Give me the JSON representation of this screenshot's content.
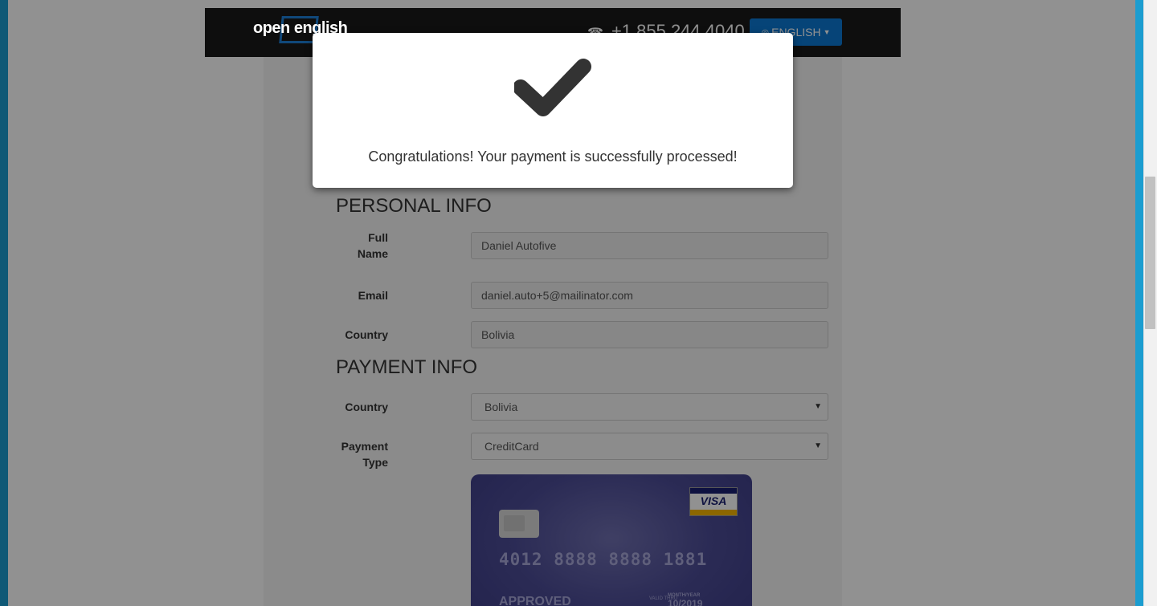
{
  "header": {
    "logo_text": "open english",
    "phone": "+1 855 244 4040",
    "language_button": "ENGLISH"
  },
  "personal_info": {
    "title": "PERSONAL INFO",
    "full_name_label_1": "Full",
    "full_name_label_2": "Name",
    "full_name_value": "Daniel Autofive",
    "email_label": "Email",
    "email_value": "daniel.auto+5@mailinator.com",
    "country_label": "Country",
    "country_value": "Bolivia"
  },
  "payment_info": {
    "title": "PAYMENT INFO",
    "country_label": "Country",
    "country_selected": "Bolivia",
    "payment_type_label_1": "Payment",
    "payment_type_label_2": "Type",
    "payment_type_selected": "CreditCard"
  },
  "card": {
    "brand": "VISA",
    "number": "4012 8888 8888 1881",
    "status": "APPROVED",
    "valid_thru": "VALID THRU",
    "month_year_label": "MONTH/YEAR",
    "expiry": "10/2019"
  },
  "modal": {
    "message": "Congratulations! Your payment is successfully processed!"
  },
  "colors": {
    "accent": "#0b78d4",
    "frame": "#1b9dd0",
    "card": "#4c4c96"
  }
}
